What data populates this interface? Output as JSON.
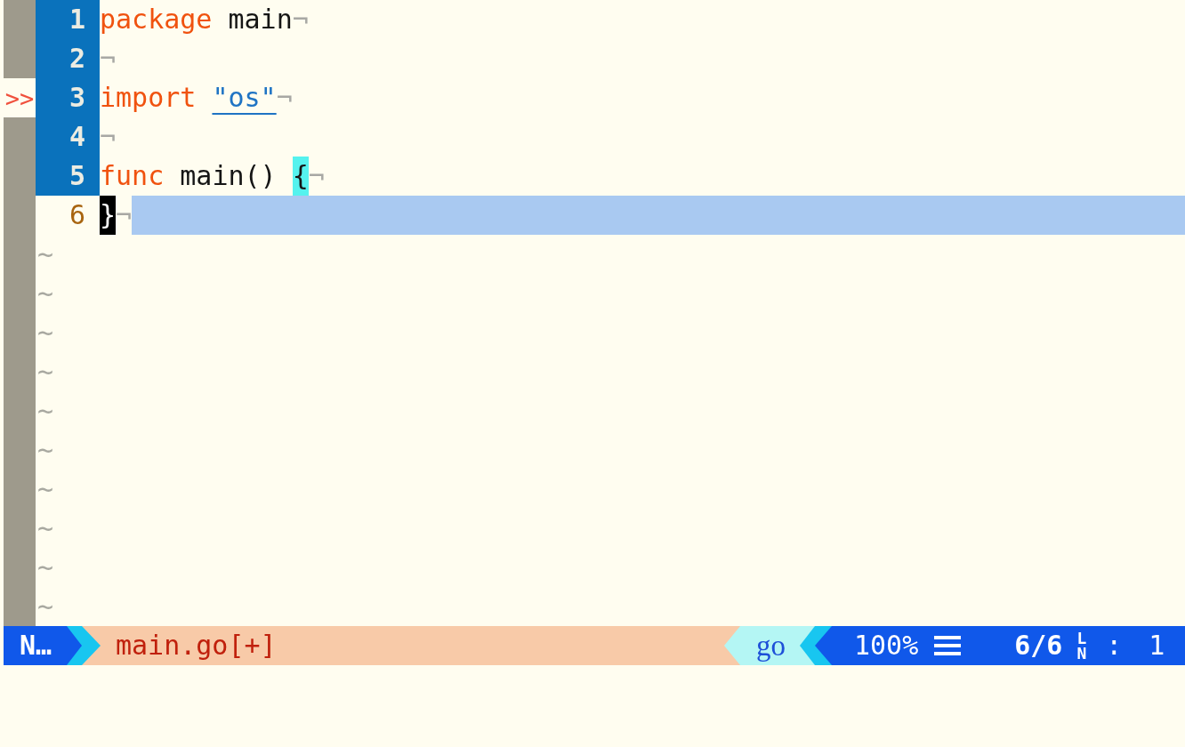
{
  "editor": {
    "lines": [
      {
        "number": "1",
        "number_highlighted": true,
        "highlighted": false,
        "tokens": [
          {
            "text": "package",
            "kind": "keyword"
          },
          {
            "text": " main",
            "kind": "plain"
          }
        ],
        "eol_marker": "¬"
      },
      {
        "number": "2",
        "number_highlighted": true,
        "highlighted": false,
        "eol_marker": "¬"
      },
      {
        "number": "3",
        "sign": ">>",
        "number_highlighted": true,
        "highlighted": false,
        "tokens": [
          {
            "text": "import ",
            "kind": "keyword"
          },
          {
            "text": "\"os\"",
            "kind": "string"
          }
        ],
        "eol_marker": "¬"
      },
      {
        "number": "4",
        "number_highlighted": true,
        "highlighted": false,
        "eol_marker": "¬"
      },
      {
        "number": "5",
        "number_highlighted": true,
        "highlighted": false,
        "tokens": [
          {
            "text": "func",
            "kind": "keyword"
          },
          {
            "text": " main() ",
            "kind": "plain"
          },
          {
            "text": "{",
            "kind": "matched_bracket"
          }
        ],
        "eol_marker": "¬"
      },
      {
        "number": "6",
        "number_highlighted": false,
        "highlighted": true,
        "tokens": [
          {
            "text": "}",
            "kind": "cursor"
          }
        ],
        "eol_marker": "¬"
      }
    ],
    "filler_lines": [
      "~",
      "~",
      "~",
      "~",
      "~",
      "~",
      "~",
      "~",
      "~",
      "~"
    ]
  },
  "status_bar": {
    "mode": "N…",
    "file": "main.go[+]",
    "filetype": "go",
    "percent": "100%",
    "position": "6/6",
    "line_symbol": "LN",
    "column_separator": ":",
    "column": "1"
  }
}
